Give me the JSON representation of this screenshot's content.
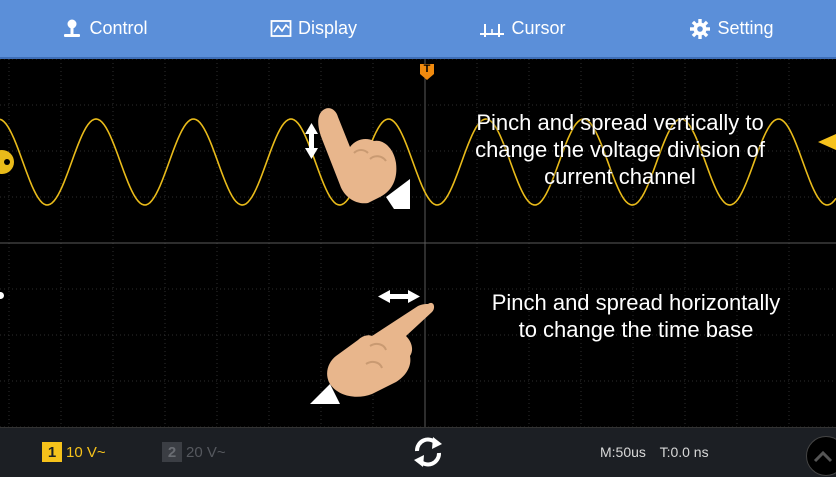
{
  "menu": {
    "control": "Control",
    "display": "Display",
    "cursor": "Cursor",
    "setting": "Setting"
  },
  "annotations": {
    "vertical_line1": "Pinch and spread vertically to",
    "vertical_line2": "change the voltage division of",
    "vertical_line3": "current channel",
    "horizontal_line1": "Pinch and spread horizontally",
    "horizontal_line2": "to change the time base"
  },
  "trigger_marker": "T",
  "channels": [
    {
      "number": "1",
      "value": "10 V~",
      "active": true
    },
    {
      "number": "2",
      "value": "20 V~",
      "active": false
    }
  ],
  "status": {
    "memory_timebase": "M:50us",
    "trigger_offset": "T:0.0 ns"
  },
  "colors": {
    "topbar": "#5b8fd9",
    "channel1": "#f6c21b",
    "channel2_inactive": "#55585e",
    "bottombar": "#1c1f24"
  },
  "icons": [
    "control-icon",
    "display-icon",
    "cursor-icon",
    "setting-icon",
    "sync-icon",
    "hand-icon"
  ]
}
